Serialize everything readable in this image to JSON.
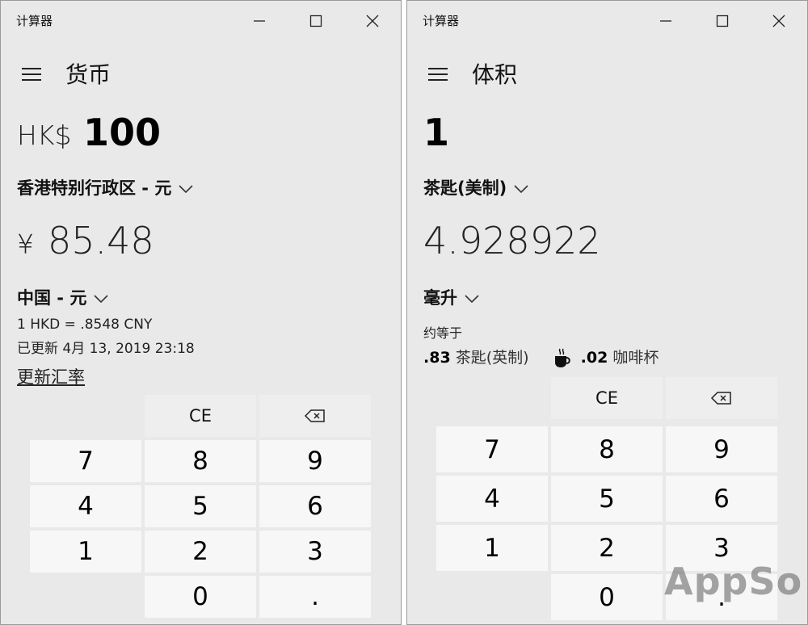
{
  "left_window": {
    "app_title": "计算器",
    "mode_title": "货币",
    "from": {
      "symbol": "HK$",
      "value": "100",
      "unit": "香港特别行政区 - 元"
    },
    "to": {
      "symbol": "¥",
      "value": "85.48",
      "unit": "中国 - 元"
    },
    "rate": "1 HKD = .8548 CNY",
    "updated": "已更新 4月 13, 2019 23:18",
    "update_link": "更新汇率",
    "keypad": {
      "ce": "CE",
      "keys": [
        "7",
        "8",
        "9",
        "4",
        "5",
        "6",
        "1",
        "2",
        "3",
        "0",
        "."
      ]
    }
  },
  "right_window": {
    "app_title": "计算器",
    "mode_title": "体积",
    "from": {
      "value": "1",
      "unit": "茶匙(美制)"
    },
    "to": {
      "value": "4.928922",
      "unit": "毫升"
    },
    "approx_label": "约等于",
    "approx_items": [
      {
        "value": ".83",
        "unit": "茶匙(英制)"
      },
      {
        "icon": "coffee-cup-icon",
        "value": ".02",
        "unit": "咖啡杯"
      }
    ],
    "keypad": {
      "ce": "CE",
      "keys": [
        "7",
        "8",
        "9",
        "4",
        "5",
        "6",
        "1",
        "2",
        "3",
        "0",
        "."
      ]
    }
  },
  "watermark": "AppSo"
}
